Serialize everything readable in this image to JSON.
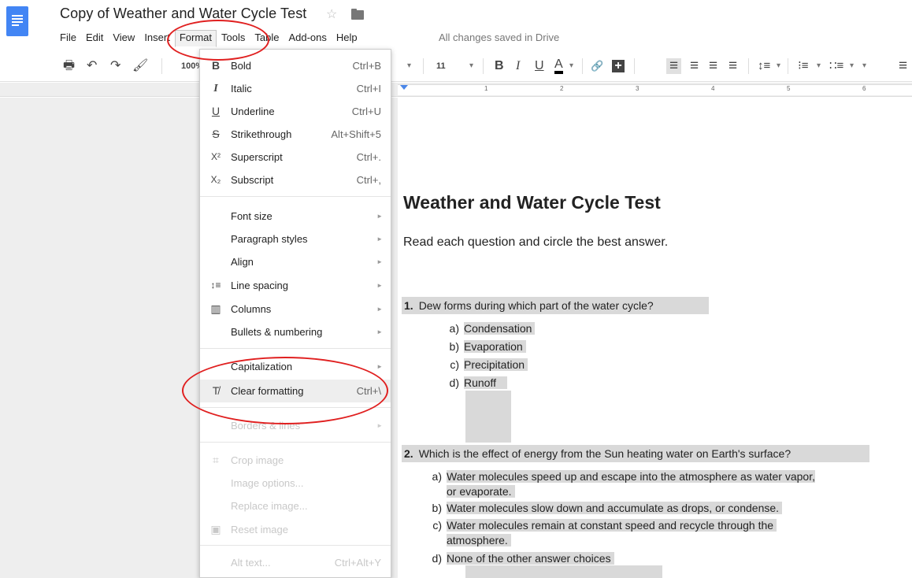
{
  "header": {
    "doc_title": "Copy of Weather and Water Cycle Test",
    "save_status": "All changes saved in Drive",
    "star_glyph": "☆"
  },
  "menubar": {
    "items": [
      "File",
      "Edit",
      "View",
      "Insert",
      "Format",
      "Tools",
      "Table",
      "Add-ons",
      "Help"
    ],
    "active": "Format"
  },
  "toolbar": {
    "print_glyph": "🖶",
    "undo_glyph": "↶",
    "redo_glyph": "↷",
    "paint_glyph": "🖌",
    "zoom": "100%",
    "font_size": "11",
    "bold": "B",
    "italic": "I",
    "underline": "U",
    "text_color": "A",
    "link_glyph": "🔗",
    "comment_glyph": "+",
    "align_left": "≡",
    "align_center": "≡",
    "align_right": "≡",
    "align_justify": "≡",
    "line_spacing": "↕≡",
    "numbered_list": "⁝≡",
    "bulleted_list": "∷≡",
    "dropdown_glyph": "▾"
  },
  "ruler": {
    "numbers": [
      "1",
      "2",
      "3",
      "4",
      "5",
      "6"
    ]
  },
  "format_menu": {
    "items": [
      {
        "icon": "B",
        "label": "Bold",
        "shortcut": "Ctrl+B"
      },
      {
        "icon": "I",
        "label": "Italic",
        "shortcut": "Ctrl+I"
      },
      {
        "icon": "U",
        "label": "Underline",
        "shortcut": "Ctrl+U"
      },
      {
        "icon": "S",
        "label": "Strikethrough",
        "shortcut": "Alt+Shift+5"
      },
      {
        "icon": "X²",
        "label": "Superscript",
        "shortcut": "Ctrl+."
      },
      {
        "icon": "X₂",
        "label": "Subscript",
        "shortcut": "Ctrl+,"
      },
      {
        "label": "Font size"
      },
      {
        "label": "Paragraph styles"
      },
      {
        "label": "Align"
      },
      {
        "icon": "↕≡",
        "label": "Line spacing"
      },
      {
        "icon": "▥",
        "label": "Columns"
      },
      {
        "label": "Bullets & numbering"
      },
      {
        "label": "Capitalization"
      },
      {
        "icon": "T̸",
        "label": "Clear formatting",
        "shortcut": "Ctrl+\\"
      },
      {
        "label": "Borders & lines"
      },
      {
        "icon": "⌗",
        "label": "Crop image"
      },
      {
        "label": "Image options..."
      },
      {
        "label": "Replace image..."
      },
      {
        "icon": "▣",
        "label": "Reset image"
      },
      {
        "label": "Alt text...",
        "shortcut": "Ctrl+Alt+Y"
      }
    ],
    "submenu_arrow": "►"
  },
  "document": {
    "heading": "Weather and Water Cycle Test",
    "instructions": "Read each question and circle the best answer.",
    "questions": [
      {
        "number": "1.",
        "text": "Dew forms during which part of the water cycle?",
        "answers": [
          {
            "letter": "a)",
            "text": "Condensation"
          },
          {
            "letter": "b)",
            "text": "Evaporation"
          },
          {
            "letter": "c)",
            "text": "Precipitation"
          },
          {
            "letter": "d)",
            "text": "Runoff"
          }
        ]
      },
      {
        "number": "2.",
        "text": "Which is the effect of energy from the Sun heating water on Earth's surface?",
        "answers": [
          {
            "letter": "a)",
            "text": "Water molecules speed up and escape into the atmosphere as water vapor,",
            "text2": "or evaporate."
          },
          {
            "letter": "b)",
            "text": "Water molecules slow down and accumulate as drops, or condense."
          },
          {
            "letter": "c)",
            "text": "Water molecules remain at constant speed and recycle through the",
            "text2": "atmosphere."
          },
          {
            "letter": "d)",
            "text": "None of the other answer choices"
          }
        ]
      }
    ]
  },
  "colors": {
    "docs_blue": "#4285f4",
    "highlight": "#d9d9d9",
    "annotation_red": "#e02020",
    "text_color_bar": "#000000"
  }
}
